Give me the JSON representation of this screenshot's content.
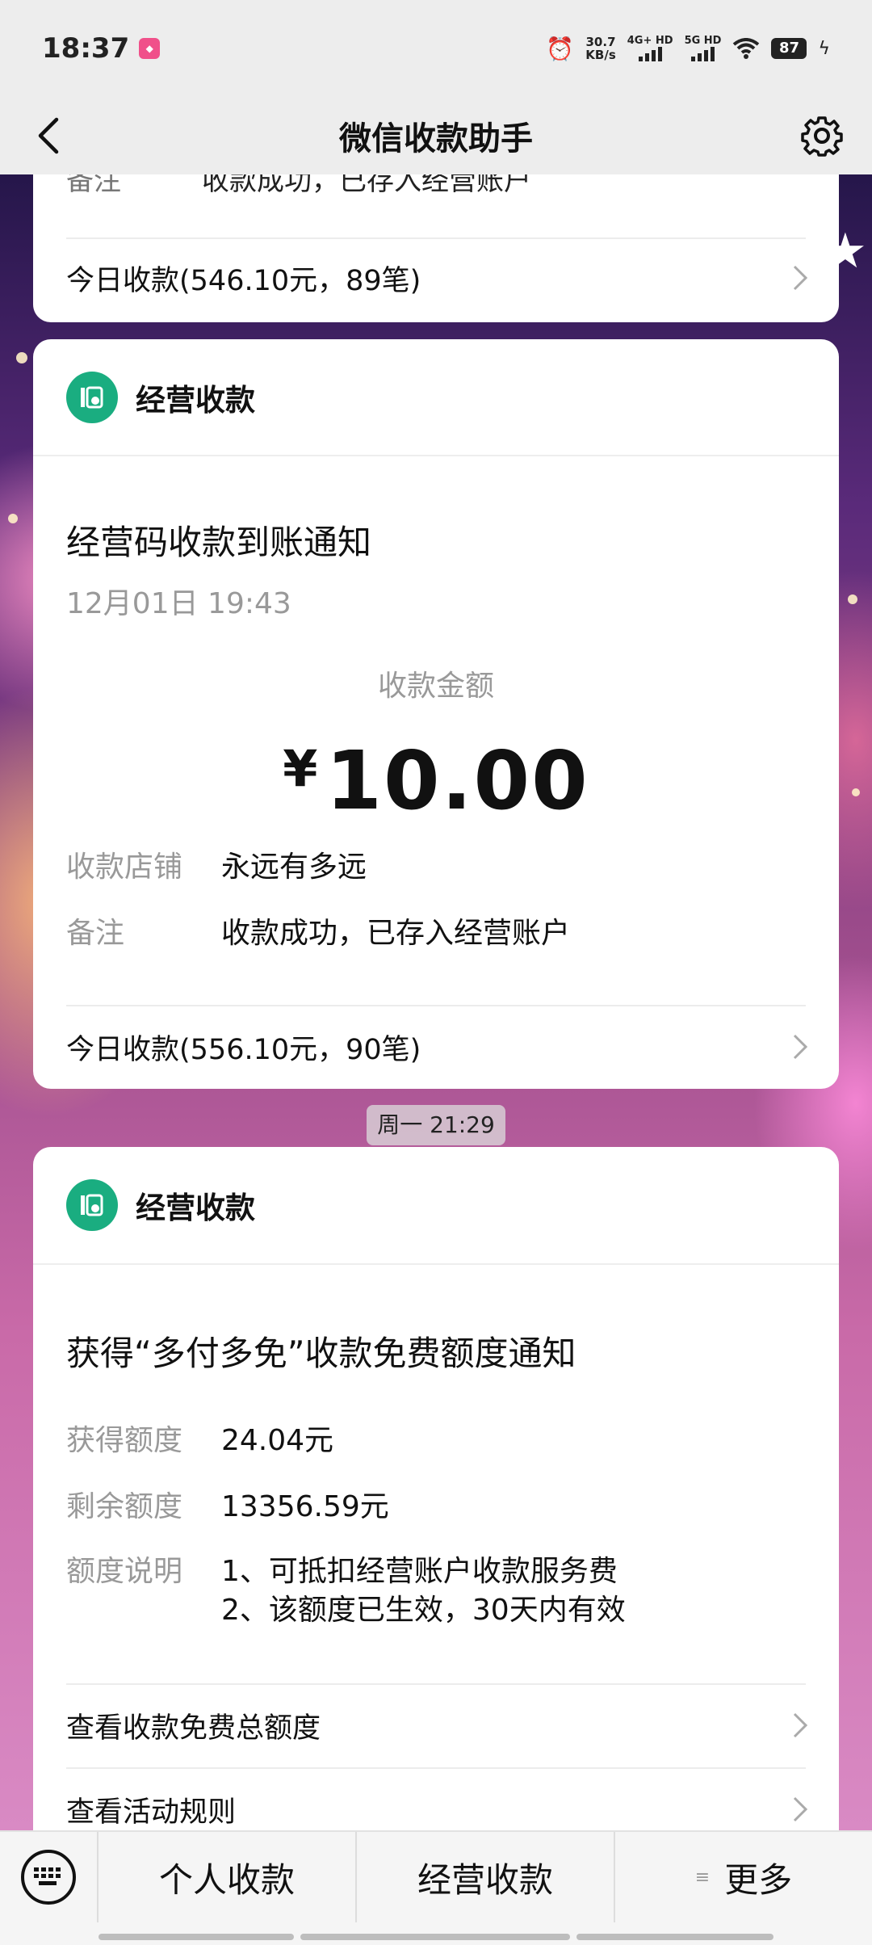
{
  "status_bar": {
    "time": "18:37",
    "speed_value": "30.7",
    "speed_unit": "KB/s",
    "net1_label": "4G+ HD",
    "net2_label": "5G HD",
    "battery": "87"
  },
  "nav": {
    "title": "微信收款助手"
  },
  "card_top": {
    "partial_key": "备注",
    "partial_value": "收款成功，已存入经营账户",
    "today_link": "今日收款(546.10元，89笔)"
  },
  "card_business": {
    "brand": "经营收款",
    "title": "经营码收款到账通知",
    "date": "12月01日 19:43",
    "amount_label": "收款金额",
    "currency": "¥",
    "amount": "10.00",
    "rows": [
      {
        "key": "收款店铺",
        "value": "永远有多远"
      },
      {
        "key": "备注",
        "value": "收款成功，已存入经营账户"
      }
    ],
    "today_link": "今日收款(556.10元，90笔)"
  },
  "time_chip": "周一 21:29",
  "card_quota": {
    "brand": "经营收款",
    "title": "获得“多付多免”收款免费额度通知",
    "rows": [
      {
        "key": "获得额度",
        "value": "24.04元"
      },
      {
        "key": "剩余额度",
        "value": "13356.59元"
      }
    ],
    "desc_key": "额度说明",
    "desc_line1": "1、可抵扣经营账户收款服务费",
    "desc_line2": "2、该额度已生效，30天内有效",
    "links": [
      "查看收款免费总额度",
      "查看活动规则"
    ]
  },
  "bottom_menu": {
    "items": [
      "个人收款",
      "经营收款",
      "更多"
    ],
    "more_glyph": "≡"
  },
  "colors": {
    "accent_green": "#1aad80",
    "nav_bg": "#ededed"
  }
}
